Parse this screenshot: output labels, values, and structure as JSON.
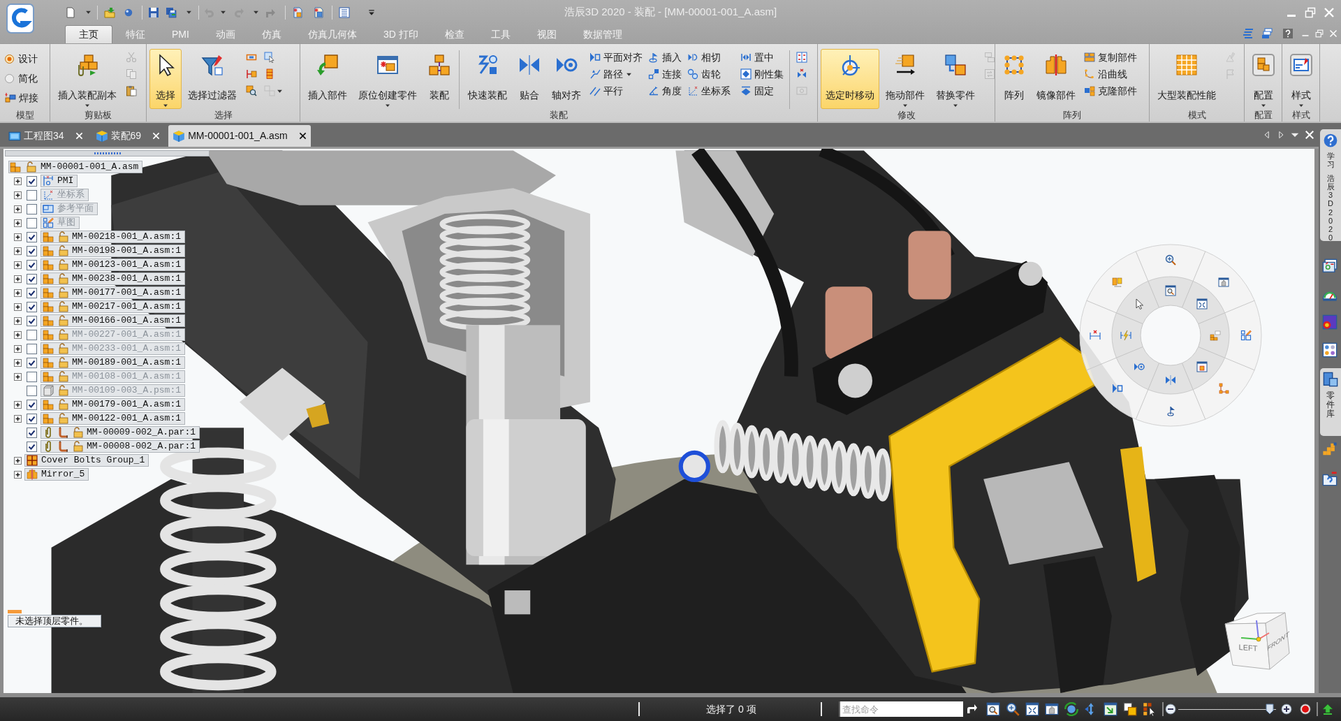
{
  "window": {
    "title": "浩辰3D 2020 - 装配 - [MM-00001-001_A.asm]"
  },
  "ribbon_tabs": [
    {
      "label": "主页",
      "selected": true
    },
    {
      "label": "特征",
      "selected": false
    },
    {
      "label": "PMI",
      "selected": false
    },
    {
      "label": "动画",
      "selected": false
    },
    {
      "label": "仿真",
      "selected": false
    },
    {
      "label": "仿真几何体",
      "selected": false
    },
    {
      "label": "3D 打印",
      "selected": false
    },
    {
      "label": "检查",
      "selected": false
    },
    {
      "label": "工具",
      "selected": false
    },
    {
      "label": "视图",
      "selected": false
    },
    {
      "label": "数据管理",
      "selected": false
    }
  ],
  "ribbon_groups": [
    {
      "label": "模型",
      "items": [
        {
          "kind": "radio",
          "label": "设计",
          "selected": true
        },
        {
          "kind": "radio",
          "label": "简化",
          "selected": false
        },
        {
          "kind": "small",
          "label": "焊接",
          "dropdown": false
        }
      ]
    },
    {
      "label": "剪贴板",
      "items": [
        {
          "kind": "large",
          "label": "插入装配副本",
          "active": false,
          "dropdown": true
        },
        {
          "kind": "icon",
          "disabled": true,
          "dropdown": false
        },
        {
          "kind": "icon",
          "disabled": true,
          "dropdown": false
        },
        {
          "kind": "icon",
          "disabled": false,
          "dropdown": false
        }
      ]
    },
    {
      "label": "选择",
      "items": [
        {
          "kind": "large",
          "label": "选择",
          "active": true,
          "dropdown": true
        },
        {
          "kind": "large",
          "label": "选择过滤器",
          "active": false,
          "dropdown": false
        },
        {
          "kind": "icon",
          "disabled": false,
          "dropdown": false
        },
        {
          "kind": "icon",
          "disabled": false,
          "dropdown": false
        },
        {
          "kind": "icon",
          "disabled": false,
          "dropdown": false
        },
        {
          "kind": "icon",
          "disabled": false,
          "dropdown": false
        },
        {
          "kind": "icon",
          "disabled": false,
          "dropdown": false
        },
        {
          "kind": "icon",
          "disabled": true,
          "dropdown": true
        }
      ]
    },
    {
      "label": "装配",
      "items": [
        {
          "kind": "large",
          "label": "插入部件",
          "active": false,
          "dropdown": false
        },
        {
          "kind": "large",
          "label": "原位创建零件",
          "active": false,
          "dropdown": true
        },
        {
          "kind": "large",
          "label": "装配",
          "active": false,
          "dropdown": false
        },
        {
          "kind": "large",
          "label": "快速装配",
          "active": false,
          "dropdown": false
        },
        {
          "kind": "large",
          "label": "贴合",
          "active": false,
          "dropdown": false
        },
        {
          "kind": "large",
          "label": "轴对齐",
          "active": false,
          "dropdown": false
        },
        {
          "kind": "small",
          "label": "平面对齐",
          "dropdown": false
        },
        {
          "kind": "small",
          "label": "路径",
          "dropdown": true
        },
        {
          "kind": "small",
          "label": "平行",
          "dropdown": false
        },
        {
          "kind": "small",
          "label": "插入",
          "dropdown": false
        },
        {
          "kind": "small",
          "label": "连接",
          "dropdown": false
        },
        {
          "kind": "small",
          "label": "角度",
          "dropdown": false
        },
        {
          "kind": "small",
          "label": "相切",
          "dropdown": false
        },
        {
          "kind": "small",
          "label": "齿轮",
          "dropdown": false
        },
        {
          "kind": "small",
          "label": "坐标系",
          "dropdown": false
        },
        {
          "kind": "small",
          "label": "置中",
          "dropdown": false
        },
        {
          "kind": "small",
          "label": "刚性集",
          "dropdown": false
        },
        {
          "kind": "small",
          "label": "固定",
          "dropdown": false
        },
        {
          "kind": "icon",
          "disabled": false,
          "dropdown": false
        },
        {
          "kind": "icon",
          "disabled": false,
          "dropdown": false
        },
        {
          "kind": "icon",
          "disabled": true,
          "dropdown": false
        }
      ]
    },
    {
      "label": "修改",
      "items": [
        {
          "kind": "large",
          "label": "选定时移动",
          "active": true,
          "dropdown": false
        },
        {
          "kind": "large",
          "label": "拖动部件",
          "active": false,
          "dropdown": true
        },
        {
          "kind": "large",
          "label": "替换零件",
          "active": false,
          "dropdown": true
        },
        {
          "kind": "icon",
          "disabled": true,
          "dropdown": false
        },
        {
          "kind": "icon",
          "disabled": true,
          "dropdown": false
        }
      ]
    },
    {
      "label": "阵列",
      "items": [
        {
          "kind": "large",
          "label": "阵列",
          "active": false,
          "dropdown": false
        },
        {
          "kind": "large",
          "label": "镜像部件",
          "active": false,
          "dropdown": false
        },
        {
          "kind": "small",
          "label": "复制部件",
          "dropdown": false
        },
        {
          "kind": "small",
          "label": "沿曲线",
          "dropdown": false
        },
        {
          "kind": "small",
          "label": "克隆部件",
          "dropdown": false
        }
      ]
    },
    {
      "label": "模式",
      "items": [
        {
          "kind": "large",
          "label": "大型装配性能",
          "active": false,
          "dropdown": false
        },
        {
          "kind": "icon",
          "disabled": true,
          "dropdown": false
        },
        {
          "kind": "icon",
          "disabled": true,
          "dropdown": false
        }
      ]
    },
    {
      "label": "配置",
      "items": [
        {
          "kind": "large",
          "label": "配置",
          "active": false,
          "dropdown": true
        }
      ]
    },
    {
      "label": "样式",
      "items": [
        {
          "kind": "large",
          "label": "样式",
          "active": false,
          "dropdown": true
        }
      ]
    }
  ],
  "document_tabs": [
    {
      "label": "工程图34",
      "selected": false
    },
    {
      "label": "装配69",
      "selected": false
    },
    {
      "label": "MM-00001-001_A.asm",
      "selected": true
    }
  ],
  "model_tree": {
    "label": "MM-00001-001_A.asm",
    "children": [
      {
        "kind": "pmi",
        "label": "PMI",
        "checked": true,
        "expanded": false
      },
      {
        "kind": "coordinate_systems",
        "label": "坐标系",
        "checked": false,
        "expanded": false
      },
      {
        "kind": "reference_planes",
        "label": "参考平面",
        "checked": false,
        "expanded": false
      },
      {
        "kind": "sketches",
        "label": "草图",
        "checked": false,
        "expanded": false
      },
      {
        "kind": "assembly",
        "label": "MM-00218-001_A.asm:1",
        "checked": true,
        "expanded": false
      },
      {
        "kind": "assembly",
        "label": "MM-00198-001_A.asm:1",
        "checked": true,
        "expanded": false
      },
      {
        "kind": "assembly",
        "label": "MM-00123-001_A.asm:1",
        "checked": true,
        "expanded": false
      },
      {
        "kind": "assembly",
        "label": "MM-00238-001_A.asm:1",
        "checked": true,
        "expanded": false
      },
      {
        "kind": "assembly",
        "label": "MM-00177-001_A.asm:1",
        "checked": true,
        "expanded": false
      },
      {
        "kind": "assembly",
        "label": "MM-00217-001_A.asm:1",
        "checked": true,
        "expanded": false
      },
      {
        "kind": "assembly",
        "label": "MM-00166-001_A.asm:1",
        "checked": true,
        "expanded": false
      },
      {
        "kind": "assembly",
        "label": "MM-00227-001_A.asm:1",
        "checked": false,
        "expanded": false
      },
      {
        "kind": "assembly",
        "label": "MM-00233-001_A.asm:1",
        "checked": false,
        "expanded": false
      },
      {
        "kind": "assembly",
        "label": "MM-00189-001_A.asm:1",
        "checked": true,
        "expanded": false
      },
      {
        "kind": "assembly",
        "label": "MM-00108-001_A.asm:1",
        "checked": false,
        "expanded": false
      },
      {
        "kind": "sheet_metal",
        "label": "MM-00109-003_A.psm:1",
        "checked": false
      },
      {
        "kind": "assembly",
        "label": "MM-00179-001_A.asm:1",
        "checked": true,
        "expanded": false
      },
      {
        "kind": "assembly",
        "label": "MM-00122-001_A.asm:1",
        "checked": true,
        "expanded": false
      },
      {
        "kind": "part",
        "label": "MM-00009-002_A.par:1",
        "checked": true
      },
      {
        "kind": "part",
        "label": "MM-00008-002_A.par:1",
        "checked": true
      },
      {
        "kind": "pattern",
        "label": "Cover Bolts Group_1",
        "expanded": false
      },
      {
        "kind": "mirror",
        "label": "Mirror_5",
        "expanded": false
      }
    ]
  },
  "viewport": {
    "hint": "未选择顶层零件。",
    "view_cube": {
      "faces": [
        "LEFT",
        "FRONT"
      ]
    }
  },
  "side_tabs": [
    {
      "lines": [
        "学习",
        "浩辰3D 2020"
      ]
    },
    {
      "lines": [
        "零件库"
      ]
    }
  ],
  "status_bar": {
    "selection": "选择了 0 项",
    "command_search": {
      "placeholder": "查找命令"
    },
    "zoom_slider": {
      "level": 0.94
    }
  }
}
